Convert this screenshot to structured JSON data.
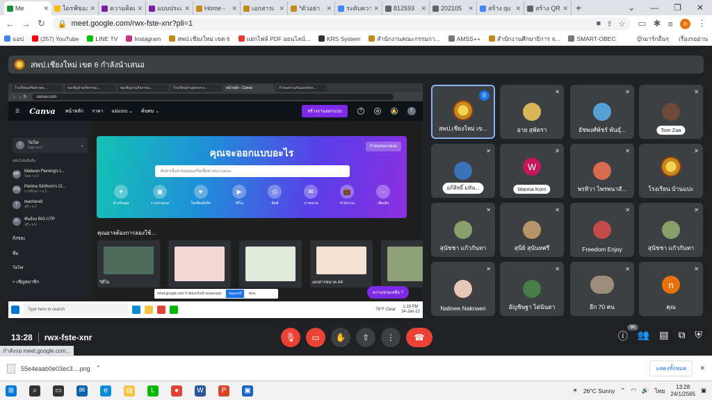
{
  "browser": {
    "tabs": [
      {
        "label": "Me",
        "color": "#1e8e3e",
        "active": true
      },
      {
        "label": "ไดรฟ์ของ",
        "color": "#fbbc04"
      },
      {
        "label": "ความคิดเ",
        "color": "#7b1fa2"
      },
      {
        "label": "แบบประเ",
        "color": "#7b1fa2"
      },
      {
        "label": "Home -",
        "color": "#c58a1e"
      },
      {
        "label": "เอกสารเ",
        "color": "#c58a1e"
      },
      {
        "label": "*ตัวอย่า",
        "color": "#c58a1e"
      },
      {
        "label": "ระดับควา",
        "color": "#4285f4"
      },
      {
        "label": "812593",
        "color": "#5f6368"
      },
      {
        "label": "202105",
        "color": "#5f6368"
      },
      {
        "label": "สร้าง qu",
        "color": "#4285f4"
      },
      {
        "label": "สร้าง QR",
        "color": "#5f6368"
      }
    ],
    "new_tab": "+",
    "window_controls": [
      "⌄",
      "—",
      "❐",
      "✕"
    ],
    "url": "meet.google.com/rwx-fste-xnr?pli=1",
    "profile_initial": "n",
    "bookmarks": [
      {
        "label": "แอป",
        "color": "#4285f4"
      },
      {
        "label": "(257) YouTube",
        "color": "#ff0000"
      },
      {
        "label": "LINE TV",
        "color": "#00c300"
      },
      {
        "label": "Instagram",
        "color": "#c13584"
      },
      {
        "label": "สพป.เชียงใหม่ เขต 6",
        "color": "#c58a1e"
      },
      {
        "label": "แยกไฟล์ PDF ออนไลน์...",
        "color": "#e53935"
      },
      {
        "label": "KRS System",
        "color": "#333333"
      },
      {
        "label": "สำนักงานคณะกรรมกา...",
        "color": "#c58a1e"
      },
      {
        "label": "AMSS++",
        "color": "#777777"
      },
      {
        "label": "สำนักงานศึกษาธิการ จ...",
        "color": "#c58a1e"
      },
      {
        "label": "SMART-OBEC",
        "color": "#777777"
      }
    ],
    "bookmarks_right": [
      "บุ๊กมาร์กอื่นๆ",
      "เรื่องรออ่าน"
    ]
  },
  "meet": {
    "presenting_text": "สพป.เชียงใหม่ เขต 6 กำลังนำเสนอ",
    "time": "13:28",
    "meeting_code": "rwx-fste-xnr",
    "participant_count": "86",
    "participants": [
      {
        "name": "สพป.เชียงใหม่ เข...",
        "type": "logo",
        "speaking": true
      },
      {
        "name": "อาย สุพัตรา",
        "type": "photo",
        "color": "#d9b65a"
      },
      {
        "name": "ธัชพงศ์พัชร์ พันธุ์...",
        "type": "photo",
        "color": "#56a0d3"
      },
      {
        "name": "Tom Zaa",
        "type": "photo",
        "color": "#6b4a3a",
        "pill": true
      },
      {
        "name": "อภิสิทธิ์ มหัน...",
        "type": "photo",
        "color": "#3b73b9",
        "pill": true
      },
      {
        "name": "Wanna Korn",
        "type": "letter",
        "letter": "W",
        "color": "#c2185b",
        "pill": true
      },
      {
        "name": "พรทิวา ไพรพนาสั...",
        "type": "photo",
        "color": "#d86a4f"
      },
      {
        "name": "โรงเรียน บ้านแปะ",
        "type": "logo"
      },
      {
        "name": "สุนัชชา แก้วกันทา",
        "type": "photo",
        "color": "#8aa06a"
      },
      {
        "name": "สุนีย์ สุนันทศรี",
        "type": "photo",
        "color": "#b89468"
      },
      {
        "name": "Freedom Enjoy",
        "type": "photo",
        "color": "#c24a4a"
      },
      {
        "name": "สุนัชชา แก้วกันทา",
        "type": "photo",
        "color": "#8aa06a"
      },
      {
        "name": "Nalinee Naknaen",
        "type": "photo",
        "color": "#e6c7b5"
      },
      {
        "name": "อัญชิษฐา ไฝนันตา",
        "type": "photo",
        "color": "#4a7c4a"
      },
      {
        "name": "อีก 70 คน",
        "type": "group",
        "color": "#9c8d7a"
      },
      {
        "name": "คุณ",
        "type": "letter",
        "letter": "n",
        "color": "#e8710a"
      }
    ]
  },
  "shared_screen": {
    "tabs": [
      "โรงเรียนเครือข่ายต...",
      "ขอเชิญร่วมกิจกรรม...",
      "ขอเชิญร่วมกิจกรรม...",
      "โรงเรียนบ้านทุ่งกลาง...",
      "หน้าหลัก - Canva",
      "กำหนดร่วมกันแผนกิจก..."
    ],
    "url": "canva.com",
    "canva_logo": "Canva",
    "nav": [
      "หน้าหลัก",
      "ราคา",
      "แม่แบบ ⌄",
      "ค้นพบ ⌄"
    ],
    "create_button": "สร้างงานออกแบบ",
    "team_name": "TaTar",
    "team_sub": "ไม่ค • ผ 2",
    "accounts_header": "สลับไปยังทีมอื่น",
    "accounts": [
      {
        "initials": "MF",
        "name": "Maliwan Fleming's t...",
        "sub": "ไม่ค • ผ 2"
      },
      {
        "initials": "PS",
        "name": "Parima Sirithorn's Cl...",
        "sub": "การศึกษา • ผ 2"
      },
      {
        "initials": "T",
        "name": "teacherall",
        "sub": "ฟรี • ผ 2"
      },
      {
        "initials": "P",
        "name": "พันธ์อง BIG UTP",
        "sub": "ฟรี • ผ 6"
      }
    ],
    "side_items": [
      "ถังขยะ",
      "ทีม",
      "TaTar",
      "+ เชิญสมาชิก"
    ],
    "hero_title": "คุณจะออกแบบอะไร",
    "hero_button": "กำหนดขนาดเอง",
    "search_placeholder": "ค้นหาเนื้อหาของคุณหรือเนื้อหาของ Canva",
    "categories": [
      "สำหรับคุณ",
      "งานนำเสนอ",
      "โซเชียลมีเดีย",
      "วิดีโอ",
      "พิมพ์",
      "การตลาด",
      "สำนักงาน",
      "เพิ่มเติม"
    ],
    "sub_title": "คุณอาจต้องการลองใช้...",
    "thumbs": [
      {
        "label": "วิดีโอ",
        "color": "#4d6b5a"
      },
      {
        "label": "",
        "color": "#f3d7d7"
      },
      {
        "label": "",
        "color": "#dfeadb"
      },
      {
        "label": "เอกสารขนาด A4",
        "color": "#f4e1d1"
      },
      {
        "label": "",
        "color": "#8e9f7a"
      }
    ],
    "help_button": "ความช่วยเหลือ ?",
    "share_notice": "meet.google.com กำลังแชร์หน้าจอของคุณ",
    "share_stop": "หยุดแชร์",
    "share_hide": "ซ่อน",
    "taskbar_search": "Type here to search",
    "taskbar_weather": "78°F Clear",
    "taskbar_time": "1:28 PM",
    "taskbar_date": "24-Jan-22"
  },
  "status_text": "กำลังรอ meet.google.com...",
  "download": {
    "filename": "55e4eaab0e03ec3....png",
    "show_all": "แสดงทั้งหมด"
  },
  "windows": {
    "weather": "26°C  Sunny",
    "lang": "ไทย",
    "time": "13:28",
    "date": "24/1/2565",
    "apps": [
      {
        "name": "start",
        "color": "#0078d4",
        "glyph": "⊞"
      },
      {
        "name": "search",
        "color": "#333333",
        "glyph": "⌕"
      },
      {
        "name": "task-view",
        "color": "#333333",
        "glyph": "▭"
      },
      {
        "name": "mail",
        "color": "#0a64ad",
        "glyph": "✉"
      },
      {
        "name": "edge",
        "color": "#0c8bd6",
        "glyph": "e"
      },
      {
        "name": "file-explorer",
        "color": "#f5c242",
        "glyph": "▤"
      },
      {
        "name": "line",
        "color": "#00b900",
        "glyph": "L"
      },
      {
        "name": "chrome",
        "color": "#db4437",
        "glyph": "●"
      },
      {
        "name": "word",
        "color": "#2b579a",
        "glyph": "W"
      },
      {
        "name": "powerpoint",
        "color": "#d24726",
        "glyph": "P"
      },
      {
        "name": "photos",
        "color": "#1565c0",
        "glyph": "▣"
      }
    ]
  }
}
